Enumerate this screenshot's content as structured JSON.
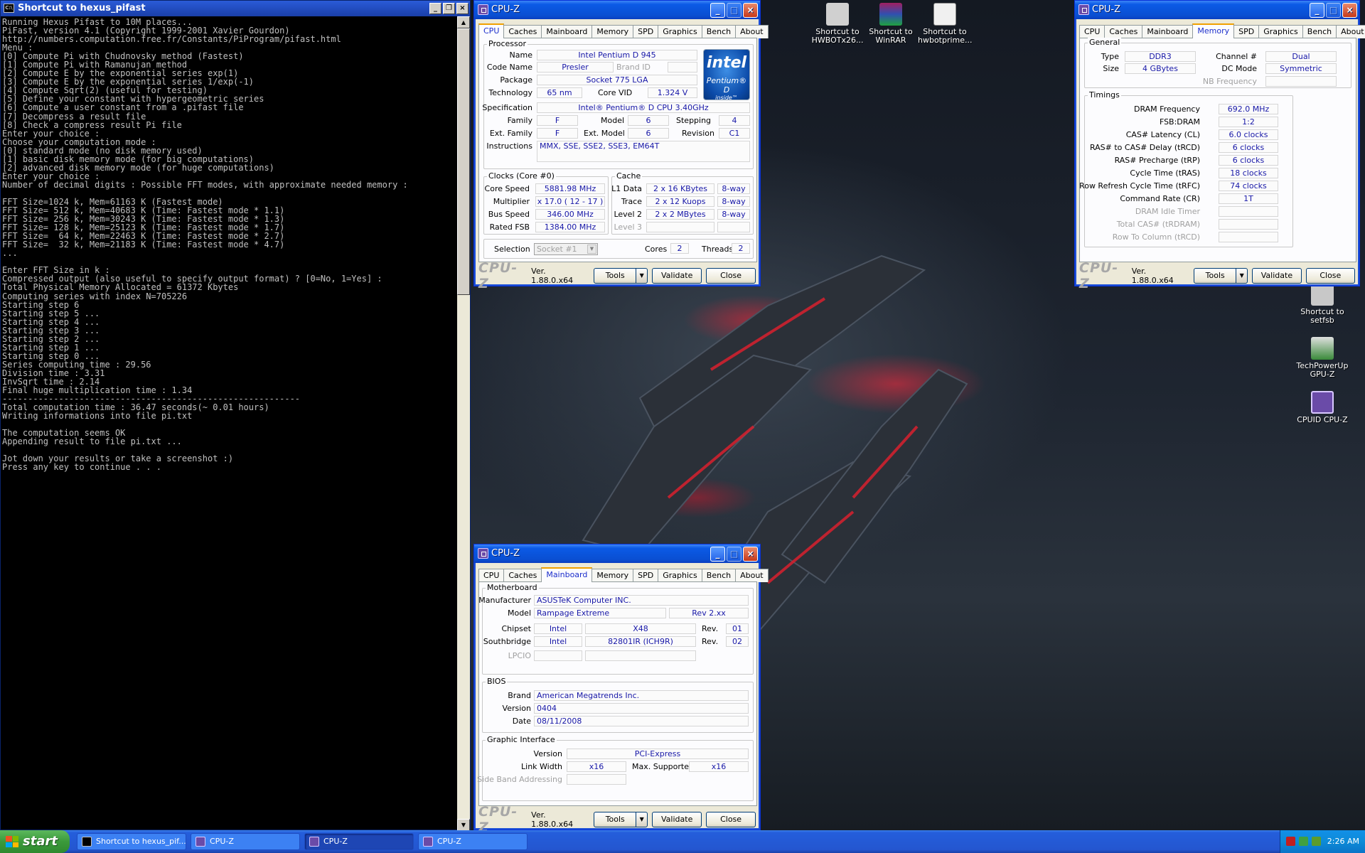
{
  "console": {
    "title": "Shortcut to hexus_pifast",
    "lines": [
      "Running Hexus Pifast to 10M places...",
      "PiFast, version 4.1 (Copyright 1999-2001 Xavier Gourdon)",
      "http://numbers.computation.free.fr/Constants/PiProgram/pifast.html",
      "Menu :",
      "[0] Compute Pi with Chudnovsky method (Fastest)",
      "[1] Compute Pi with Ramanujan method",
      "[2] Compute E by the exponential series exp(1)",
      "[3] Compute E by the exponential series 1/exp(-1)",
      "[4] Compute Sqrt(2) (useful for testing)",
      "[5] Define your constant with hypergeometric series",
      "[6] Compute a user constant from a .pifast file",
      "[7] Decompress a result file",
      "[8] Check a compress result Pi file",
      "Enter your choice :",
      "Choose your computation mode :",
      "[0] standard mode (no disk memory used)",
      "[1] basic disk memory mode (for big computations)",
      "[2] advanced disk memory mode (for huge computations)",
      "Enter your choice :",
      "Number of decimal digits : Possible FFT modes, with approximate needed memory :",
      "",
      "FFT Size=1024 k, Mem=61163 K (Fastest mode)",
      "FFT Size= 512 k, Mem=40683 K (Time: Fastest mode * 1.1)",
      "FFT Size= 256 k, Mem=30243 K (Time: Fastest mode * 1.3)",
      "FFT Size= 128 k, Mem=25123 K (Time: Fastest mode * 1.7)",
      "FFT Size=  64 k, Mem=22463 K (Time: Fastest mode * 2.7)",
      "FFT Size=  32 k, Mem=21183 K (Time: Fastest mode * 4.7)",
      "...",
      "",
      "Enter FFT Size in k :",
      "Compressed output (also useful to specify output format) ? [0=No, 1=Yes] :",
      "Total Physical Memory Allocated = 61372 Kbytes",
      "Computing series with index N=705226",
      "Starting step 6",
      "Starting step 5 ...",
      "Starting step 4 ...",
      "Starting step 3 ...",
      "Starting step 2 ...",
      "Starting step 1 ...",
      "Starting step 0 ...",
      "Series computing time : 29.56",
      "Division time : 3.31",
      "InvSqrt time : 2.14",
      "Final huge multiplication time : 1.34",
      "----------------------------------------------------------",
      "Total computation time : 36.47 seconds(~ 0.01 hours)",
      "Writing informations into file pi.txt",
      "",
      "The computation seems OK",
      "Appending result to file pi.txt ...",
      "",
      "Jot down your results or take a screenshot :)",
      "Press any key to continue . . ."
    ]
  },
  "cpuz": {
    "title": "CPU-Z",
    "tabs": [
      "CPU",
      "Caches",
      "Mainboard",
      "Memory",
      "SPD",
      "Graphics",
      "Bench",
      "About"
    ],
    "logo": "CPU-Z",
    "version": "Ver. 1.88.0.x64",
    "tools": "Tools",
    "validate": "Validate",
    "close": "Close"
  },
  "cpu": {
    "processor": "Processor",
    "name_l": "Name",
    "name": "Intel Pentium D 945",
    "code_l": "Code Name",
    "code": "Presler",
    "brand_l": "Brand ID",
    "pkg_l": "Package",
    "pkg": "Socket 775 LGA",
    "tech_l": "Technology",
    "tech": "65 nm",
    "vid_l": "Core VID",
    "vid": "1.324 V",
    "spec_l": "Specification",
    "spec": "Intel® Pentium® D CPU 3.40GHz",
    "fam_l": "Family",
    "fam": "F",
    "model_l": "Model",
    "model": "6",
    "step_l": "Stepping",
    "step": "4",
    "efam_l": "Ext. Family",
    "efam": "F",
    "emodel_l": "Ext. Model",
    "emodel": "6",
    "rev_l": "Revision",
    "rev": "C1",
    "inst_l": "Instructions",
    "inst": "MMX, SSE, SSE2, SSE3, EM64T",
    "clocks": "Clocks (Core #0)",
    "cs_l": "Core Speed",
    "cs": "5881.98 MHz",
    "mul_l": "Multiplier",
    "mul": "x 17.0 ( 12 - 17 )",
    "bus_l": "Bus Speed",
    "bus": "346.00 MHz",
    "fsb_l": "Rated FSB",
    "fsb": "1384.00 MHz",
    "cache": "Cache",
    "l1_l": "L1 Data",
    "l1": "2 x 16 KBytes",
    "l1w": "8-way",
    "tr_l": "Trace",
    "tr": "2 x 12 Kuops",
    "trw": "8-way",
    "l2_l": "Level 2",
    "l2": "2 x 2 MBytes",
    "l2w": "8-way",
    "l3_l": "Level 3",
    "sel_l": "Selection",
    "sel": "Socket #1",
    "cores_l": "Cores",
    "cores": "2",
    "thr_l": "Threads",
    "thr": "2",
    "intel": "intel",
    "pd": "Pentium® D",
    "inside": "inside™"
  },
  "mem": {
    "general": "General",
    "type_l": "Type",
    "type": "DDR3",
    "ch_l": "Channel #",
    "ch": "Dual",
    "size_l": "Size",
    "size": "4 GBytes",
    "dc_l": "DC Mode",
    "dc": "Symmetric",
    "nb_l": "NB Frequency",
    "timings": "Timings",
    "dram_l": "DRAM Frequency",
    "dram": "692.0 MHz",
    "fsbd_l": "FSB:DRAM",
    "fsbd": "1:2",
    "cl_l": "CAS# Latency (CL)",
    "cl": "6.0 clocks",
    "trcd_l": "RAS# to CAS# Delay (tRCD)",
    "trcd": "6 clocks",
    "trp_l": "RAS# Precharge (tRP)",
    "trp": "6 clocks",
    "tras_l": "Cycle Time (tRAS)",
    "tras": "18 clocks",
    "trfc_l": "Row Refresh Cycle Time (tRFC)",
    "trfc": "74 clocks",
    "cr_l": "Command Rate (CR)",
    "cr": "1T",
    "idle_l": "DRAM Idle Timer",
    "tcas_l": "Total CAS# (tRDRAM)",
    "rtc_l": "Row To Column (tRCD)"
  },
  "mb": {
    "motherboard": "Motherboard",
    "man_l": "Manufacturer",
    "man": "ASUSTeK Computer INC.",
    "model_l": "Model",
    "model": "Rampage Extreme",
    "rev": "Rev 2.xx",
    "chip_l": "Chipset",
    "chip1": "Intel",
    "chip2": "X48",
    "crev_l": "Rev.",
    "crev": "01",
    "sb_l": "Southbridge",
    "sb1": "Intel",
    "sb2": "82801IR (ICH9R)",
    "srev_l": "Rev.",
    "srev": "02",
    "lpcio_l": "LPCIO",
    "bios": "BIOS",
    "brand_l": "Brand",
    "brand": "American Megatrends Inc.",
    "ver_l": "Version",
    "ver": "0404",
    "date_l": "Date",
    "date": "08/11/2008",
    "gi": "Graphic Interface",
    "giv_l": "Version",
    "giv": "PCI-Express",
    "lw_l": "Link Width",
    "lw": "x16",
    "ms_l": "Max. Supported",
    "ms": "x16",
    "sba_l": "Side Band Addressing"
  },
  "desktop": {
    "icons": [
      {
        "label": "Shortcut to HWBOTx26...",
        "color": "#d0d0d0"
      },
      {
        "label": "Shortcut to WinRAR",
        "color": "#a02060"
      },
      {
        "label": "Shortcut to hwbotprime...",
        "color": "#e8e8e8"
      },
      {
        "label": "Shortcut to setfsb",
        "color": "#c8c8c8"
      },
      {
        "label": "TechPowerUp GPU-Z",
        "color": "#3a8a3a"
      },
      {
        "label": "CPUID CPU-Z",
        "color": "#6a4ba8"
      }
    ]
  },
  "taskbar": {
    "start": "start",
    "items": [
      "Shortcut to hexus_pif...",
      "CPU-Z",
      "CPU-Z",
      "CPU-Z"
    ],
    "clock": "2:26 AM"
  }
}
